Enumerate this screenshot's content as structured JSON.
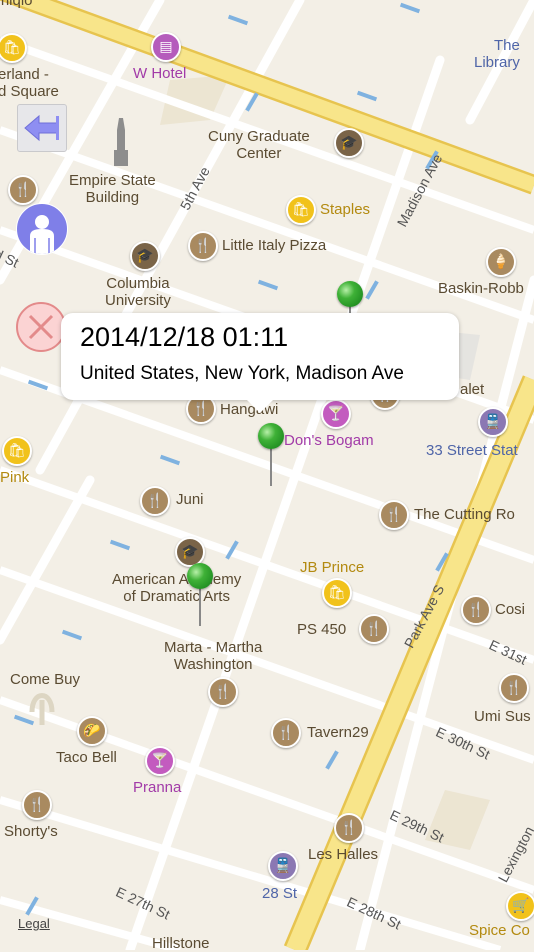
{
  "map_labels": {
    "uniqlo": "Uniqlo",
    "herald_square": "erland -\nd Square",
    "w_hotel": "W Hotel",
    "the_library": "The\nLibrary",
    "cuny": "Cuny Graduate\nCenter",
    "empire_state": "Empire State\nBuilding",
    "staples": "Staples",
    "little_italy": "Little Italy Pizza",
    "columbia": "Columbia\nUniversity",
    "baskin": "Baskin-Robb",
    "hangawi": "Hangawi",
    "dons_bogam": "Don's Bogam",
    "chalet": "alet",
    "st33": "33 Street Stat",
    "pink": "Pink",
    "juni": "Juni",
    "cutting_room": "The Cutting Ro",
    "american_academy": "American Academy\nof Dramatic Arts",
    "jb_prince": "JB Prince",
    "cosi": "Cosi",
    "ps450": "PS 450",
    "marta": "Marta - Martha\nWashington",
    "come_buy": "Come Buy",
    "umi_sushi": "Umi Sus",
    "taco_bell": "Taco Bell",
    "tavern29": "Tavern29",
    "pranna": "Pranna",
    "shortys": "Shorty's",
    "les_halles": "Les Halles",
    "st28": "28 St",
    "spice_co": "Spice Co",
    "hillstone": "Hillstone",
    "fifth_ave": "5th Ave",
    "madison_ave": "Madison Ave",
    "park_ave": "Park Ave S",
    "e31": "E 31st",
    "e30": "E 30th St",
    "e29": "E 29th St",
    "e28": "E 28th St",
    "e27": "E 27th St",
    "lexington": "Lexington",
    "st_left": "d St"
  },
  "callout": {
    "date": "2014/12/18 01:11",
    "address": "United States, New York, Madison Ave"
  },
  "controls": {
    "back_icon": "left-arrow-icon",
    "user_icon": "person-icon",
    "clear_icon": "clear-x-icon"
  },
  "legal": "Legal",
  "colors": {
    "map_bg": "#f3efe6",
    "road": "#ffffff",
    "highway": "#f8e58a",
    "pin": "#3fb137"
  }
}
